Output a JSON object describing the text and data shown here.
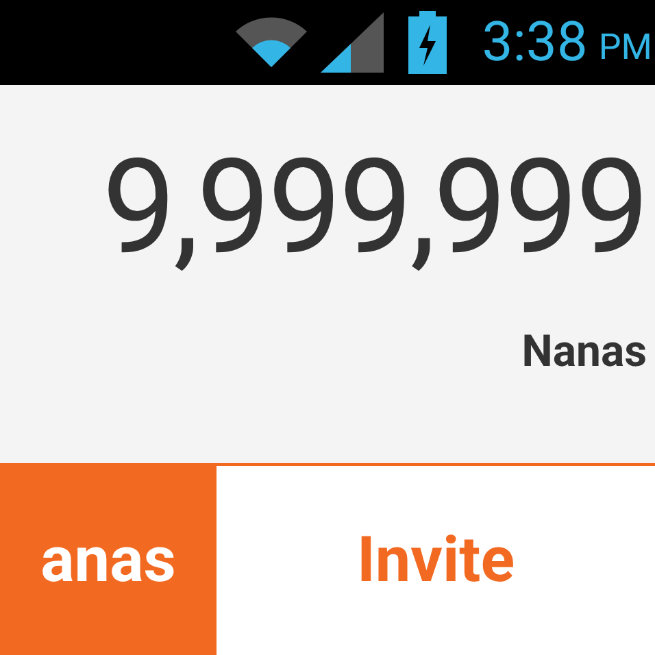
{
  "status_bar": {
    "time": "3:38",
    "period": "PM"
  },
  "balance": {
    "amount": "9,999,999",
    "unit": "Nanas"
  },
  "tabs": [
    {
      "label": "anas",
      "selected": true
    },
    {
      "label": "Invite",
      "selected": false
    }
  ]
}
